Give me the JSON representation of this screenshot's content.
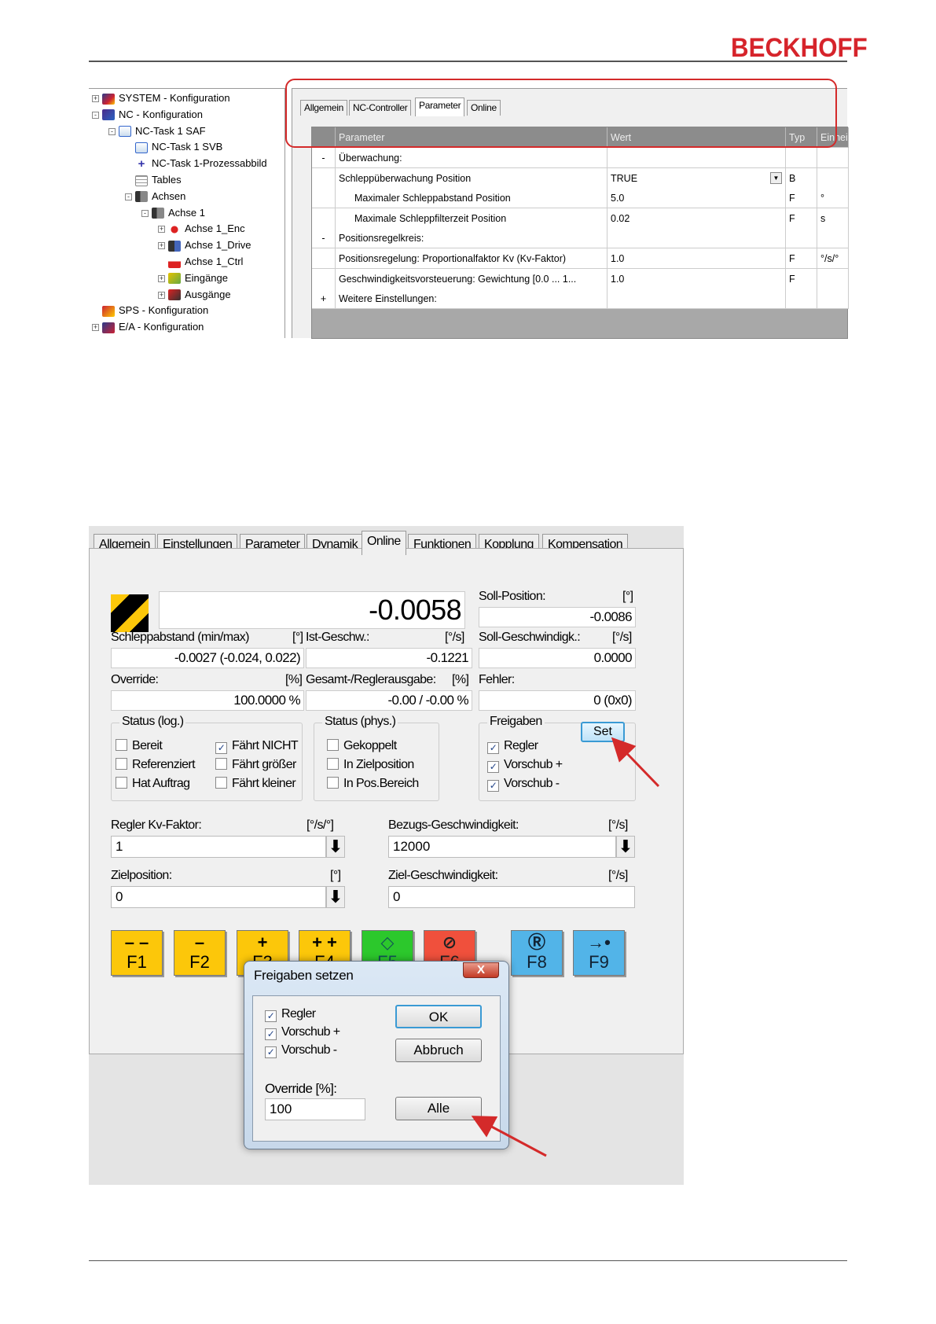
{
  "header": {
    "logo": "BECKHOFF"
  },
  "tree": {
    "items": [
      {
        "label": "SYSTEM - Konfiguration",
        "icon": "system-config-icon",
        "expander": "+"
      },
      {
        "label": "NC - Konfiguration",
        "icon": "nc-config-icon",
        "expander": "-"
      },
      {
        "label": "NC-Task 1 SAF",
        "icon": "task-icon",
        "expander": "-"
      },
      {
        "label": "NC-Task 1 SVB",
        "icon": "task-icon",
        "expander": ""
      },
      {
        "label": "NC-Task 1-Prozessabbild",
        "icon": "process-image-icon",
        "expander": ""
      },
      {
        "label": "Tables",
        "icon": "table-icon",
        "expander": ""
      },
      {
        "label": "Achsen",
        "icon": "axes-icon",
        "expander": "-"
      },
      {
        "label": "Achse 1",
        "icon": "axis-icon",
        "expander": "-"
      },
      {
        "label": "Achse 1_Enc",
        "icon": "encoder-icon",
        "expander": "+"
      },
      {
        "label": "Achse 1_Drive",
        "icon": "drive-icon",
        "expander": "+"
      },
      {
        "label": "Achse 1_Ctrl",
        "icon": "controller-icon",
        "expander": ""
      },
      {
        "label": "Eingänge",
        "icon": "inputs-icon",
        "expander": "+"
      },
      {
        "label": "Ausgänge",
        "icon": "outputs-icon",
        "expander": "+"
      },
      {
        "label": "SPS - Konfiguration",
        "icon": "plc-config-icon",
        "expander": ""
      },
      {
        "label": "E/A - Konfiguration",
        "icon": "io-config-icon",
        "expander": "+"
      }
    ]
  },
  "panel1": {
    "tabs": [
      "Allgemein",
      "NC-Controller",
      "Parameter",
      "Online"
    ],
    "active_tab": "Parameter",
    "columns": [
      "Parameter",
      "Wert",
      "Typ",
      "Einheit"
    ],
    "rows": [
      {
        "sign": "-",
        "param": "Überwachung:",
        "value": "",
        "type": "",
        "unit": ""
      },
      {
        "sign": "",
        "param": "Schleppüberwachung Position",
        "value": "TRUE",
        "type": "B",
        "unit": ""
      },
      {
        "sign": "",
        "param": "Maximaler Schleppabstand Position",
        "value": "5.0",
        "type": "F",
        "unit": "°"
      },
      {
        "sign": "",
        "param": "Maximale Schleppfilterzeit Position",
        "value": "0.02",
        "type": "F",
        "unit": "s"
      },
      {
        "sign": "-",
        "param": "Positionsregelkreis:",
        "value": "",
        "type": "",
        "unit": ""
      },
      {
        "sign": "",
        "param": "Positionsregelung: Proportionalfaktor Kv (Kv-Faktor)",
        "value": "1.0",
        "type": "F",
        "unit": "°/s/°"
      },
      {
        "sign": "",
        "param": "Geschwindigkeitsvorsteuerung: Gewichtung [0.0 ... 1...",
        "value": "1.0",
        "type": "F",
        "unit": ""
      },
      {
        "sign": "+",
        "param": "Weitere Einstellungen:",
        "value": "",
        "type": "",
        "unit": ""
      }
    ]
  },
  "panel2": {
    "tabs": [
      "Allgemein",
      "Einstellungen",
      "Parameter",
      "Dynamik",
      "Online",
      "Funktionen",
      "Kopplung",
      "Kompensation"
    ],
    "active_tab": "Online",
    "main_value": "-0.0058",
    "soll_position": {
      "label": "Soll-Position:",
      "unit": "[°]",
      "value": "-0.0086"
    },
    "schleppabstand": {
      "label": "Schleppabstand (min/max)",
      "unit": "[°]",
      "value": "-0.0027  (-0.024, 0.022)"
    },
    "ist_geschw": {
      "label": "Ist-Geschw.:",
      "unit": "[°/s]",
      "value": "-0.1221"
    },
    "soll_geschw": {
      "label": "Soll-Geschwindigk.:",
      "unit": "[°/s]",
      "value": "0.0000"
    },
    "override": {
      "label": "Override:",
      "unit": "[%]",
      "value": "100.0000 %"
    },
    "gesamt": {
      "label": "Gesamt-/Reglerausgabe:",
      "unit": "[%]",
      "value": "-0.00 / -0.00 %"
    },
    "fehler": {
      "label": "Fehler:",
      "value": "0 (0x0)"
    },
    "status_log": {
      "title": "Status (log.)",
      "items": [
        {
          "label": "Bereit",
          "checked": false
        },
        {
          "label": "Referenziert",
          "checked": false
        },
        {
          "label": "Hat Auftrag",
          "checked": false
        },
        {
          "label": "Fährt NICHT",
          "checked": true
        },
        {
          "label": "Fährt größer",
          "checked": false
        },
        {
          "label": "Fährt kleiner",
          "checked": false
        }
      ]
    },
    "status_phys": {
      "title": "Status (phys.)",
      "items": [
        {
          "label": "Gekoppelt",
          "checked": false
        },
        {
          "label": "In Zielposition",
          "checked": false
        },
        {
          "label": "In Pos.Bereich",
          "checked": false
        }
      ]
    },
    "freigaben": {
      "title": "Freigaben",
      "set_label": "Set",
      "items": [
        {
          "label": "Regler",
          "checked": true
        },
        {
          "label": "Vorschub +",
          "checked": true
        },
        {
          "label": "Vorschub -",
          "checked": true
        }
      ]
    },
    "kv": {
      "label": "Regler Kv-Faktor:",
      "unit": "[°/s/°]",
      "value": "1"
    },
    "bezug": {
      "label": "Bezugs-Geschwindigkeit:",
      "unit": "[°/s]",
      "value": "12000"
    },
    "zielpos": {
      "label": "Zielposition:",
      "unit": "[°]",
      "value": "0"
    },
    "zielgeschw": {
      "label": "Ziel-Geschwindigkeit:",
      "unit": "[°/s]",
      "value": "0"
    },
    "fkeys": [
      {
        "sym": "– –",
        "label": "F1"
      },
      {
        "sym": "–",
        "label": "F2"
      },
      {
        "sym": "+",
        "label": "F3"
      },
      {
        "sym": "+ +",
        "label": "F4"
      },
      {
        "sym": "◇",
        "label": "F5"
      },
      {
        "sym": "⊘",
        "label": "F6"
      },
      {
        "sym": "Ⓡ",
        "label": "F8"
      },
      {
        "sym": "→•",
        "label": "F9"
      }
    ],
    "arrow_symbol": "⬇"
  },
  "dialog": {
    "title": "Freigaben setzen",
    "close": "X",
    "checks": [
      {
        "label": "Regler",
        "checked": true
      },
      {
        "label": "Vorschub +",
        "checked": true
      },
      {
        "label": "Vorschub -",
        "checked": true
      }
    ],
    "ok": "OK",
    "cancel": "Abbruch",
    "override_label": "Override [%]:",
    "override_value": "100",
    "all": "Alle"
  },
  "colors": {
    "brand": "#d6242b",
    "annotation": "#d42a2a",
    "fkey_yellow": "#fcc70a",
    "fkey_green": "#2cc82c",
    "fkey_red": "#f0503c",
    "fkey_blue": "#52b4e8"
  }
}
